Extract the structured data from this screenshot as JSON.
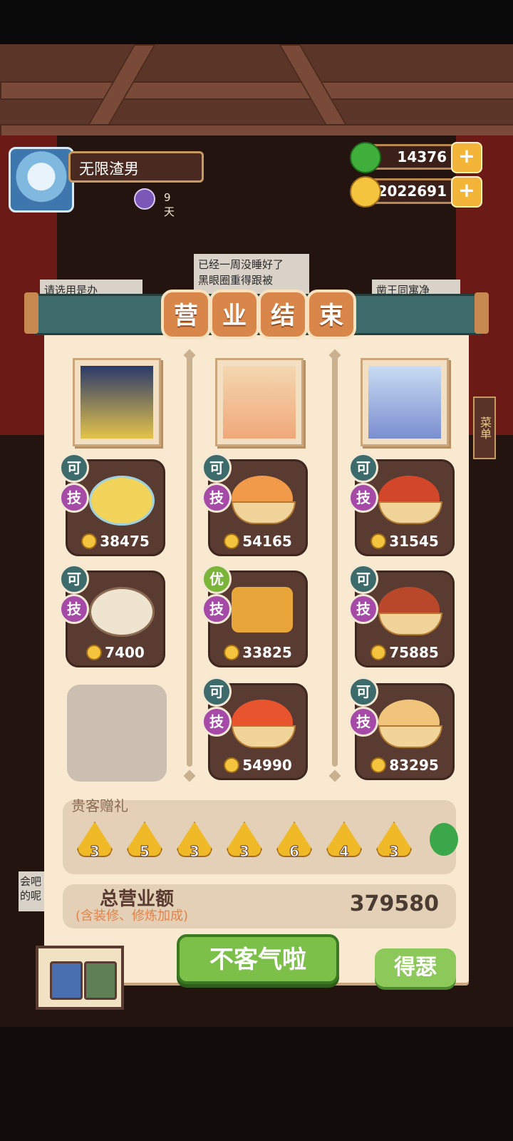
{
  "player": {
    "name": "无限渣男",
    "days": "9天"
  },
  "currency": {
    "jade": "14376",
    "coins": "2022691",
    "plus": "+"
  },
  "notices": {
    "center_line1": "已经一周没睡好了",
    "center_line2": "黑眼圈重得跟被",
    "left": "请选用是办",
    "right": "凿王同寓净",
    "side_menu": "菜单",
    "left_bottom": "会吧的呢"
  },
  "panel": {
    "title_chars": [
      "营",
      "业",
      "结",
      "束"
    ],
    "columns": [
      {
        "dishes": [
          {
            "tag": "可",
            "skill": "技",
            "price": "38475"
          },
          {
            "tag": "可",
            "skill": "技",
            "price": "7400"
          }
        ]
      },
      {
        "dishes": [
          {
            "tag": "可",
            "skill": "技",
            "price": "54165"
          },
          {
            "tag": "优",
            "skill": "技",
            "price": "33825"
          },
          {
            "tag": "可",
            "skill": "技",
            "price": "54990"
          }
        ]
      },
      {
        "dishes": [
          {
            "tag": "可",
            "skill": "技",
            "price": "31545"
          },
          {
            "tag": "可",
            "skill": "技",
            "price": "75885"
          },
          {
            "tag": "可",
            "skill": "技",
            "price": "83295"
          }
        ]
      }
    ],
    "gifts_title": "贵客赠礼",
    "gifts": [
      "3",
      "5",
      "3",
      "3",
      "6",
      "4",
      "3"
    ],
    "total_label": "总营业额",
    "total_sub": "(含装修、修炼加成)",
    "total_value": "379580",
    "confirm_button": "不客气啦",
    "brag_button": "得瑟"
  },
  "colors": {
    "accent_green": "#7cc04a",
    "panel_teal": "#3d6a6a",
    "paper": "#f8e9d0"
  }
}
